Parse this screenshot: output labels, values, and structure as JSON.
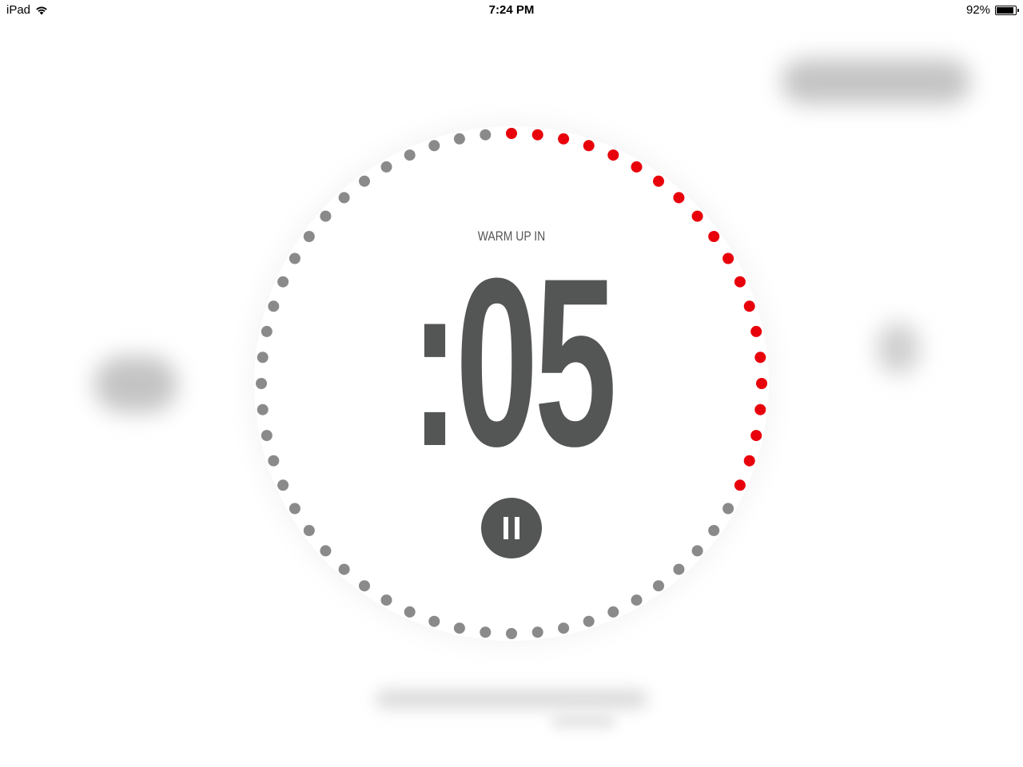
{
  "status_bar": {
    "device": "iPad",
    "time": "7:24 PM",
    "battery": "92%",
    "battery_level": 0.92
  },
  "timer": {
    "label": "WARM UP IN",
    "value": ":05",
    "total_ticks": 60,
    "active_ticks": 20,
    "active_color": "#e8000b",
    "inactive_color": "#8a8a8a",
    "text_color": "#545555"
  },
  "pause_button": {
    "icon": "pause-icon",
    "color": "#545555"
  }
}
